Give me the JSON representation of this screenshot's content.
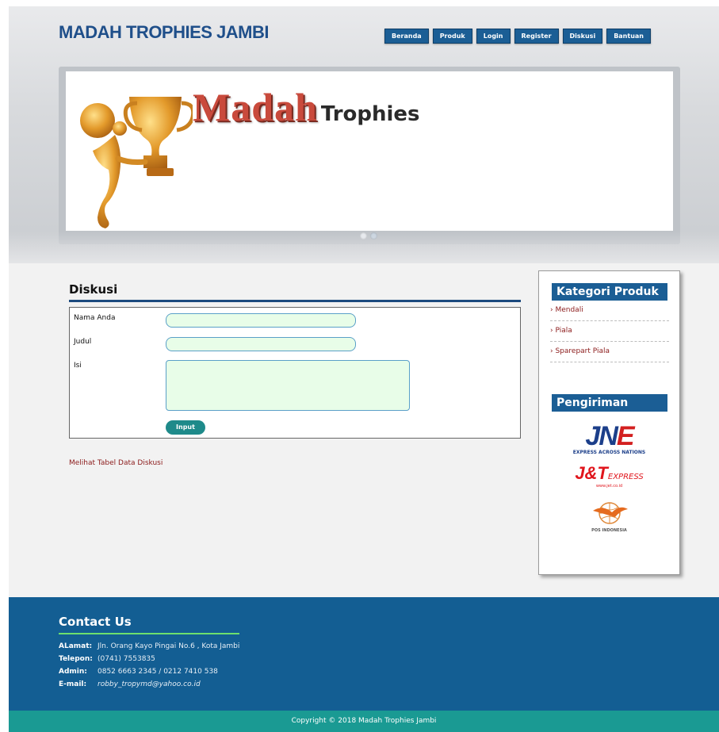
{
  "header": {
    "site_title": "MADAH TROPHIES JAMBI",
    "nav": [
      {
        "label": "Beranda"
      },
      {
        "label": "Produk"
      },
      {
        "label": "Login"
      },
      {
        "label": "Register"
      },
      {
        "label": "Diskusi"
      },
      {
        "label": "Bantuan"
      }
    ]
  },
  "banner": {
    "big_text": "Madah",
    "small_text": "Trophies",
    "slide_count": 2,
    "active_slide": 1
  },
  "main": {
    "title": "Diskusi",
    "form": {
      "name_label": "Nama Anda",
      "title_label": "Judul",
      "content_label": "Isi",
      "name_value": "",
      "title_value": "",
      "content_value": "",
      "submit_label": "Input"
    },
    "view_link": "Melihat Tabel Data Diskusi"
  },
  "sidebar": {
    "categories_title": "Kategori Produk",
    "categories": [
      "› Mendali",
      "› Piala",
      "› Sparepart Piala"
    ],
    "shipping_title": "Pengiriman",
    "logos": {
      "jne_main": "JN",
      "jne_e": "E",
      "jne_tag": "EXPRESS ACROSS NATIONS",
      "jt_main": "J&T",
      "jt_sub": "EXPRESS",
      "jt_url": "www.jet.co.id",
      "pos": "POS INDONESIA"
    }
  },
  "footer": {
    "contact_title": "Contact Us",
    "address_key": "ALamat:",
    "address_val": "Jln. Orang Kayo Pingai No.6 , Kota Jambi",
    "phone_key": "Telepon:",
    "phone_val": "(0741) 7553835",
    "admin_key": "Admin:",
    "admin_val": "0852 6663 2345 / 0212 7410 538",
    "email_key": "E-mail:",
    "email_val": "robby_tropymd@yahoo.co.id",
    "copyright": "Copyright © 2018 Madah Trophies Jambi"
  },
  "colors": {
    "brand_blue": "#1b5e95",
    "footer_blue": "#135e93",
    "copyright_teal": "#1a9a93",
    "link_red": "#8b1a1a",
    "input_bg": "#e8fde8"
  }
}
